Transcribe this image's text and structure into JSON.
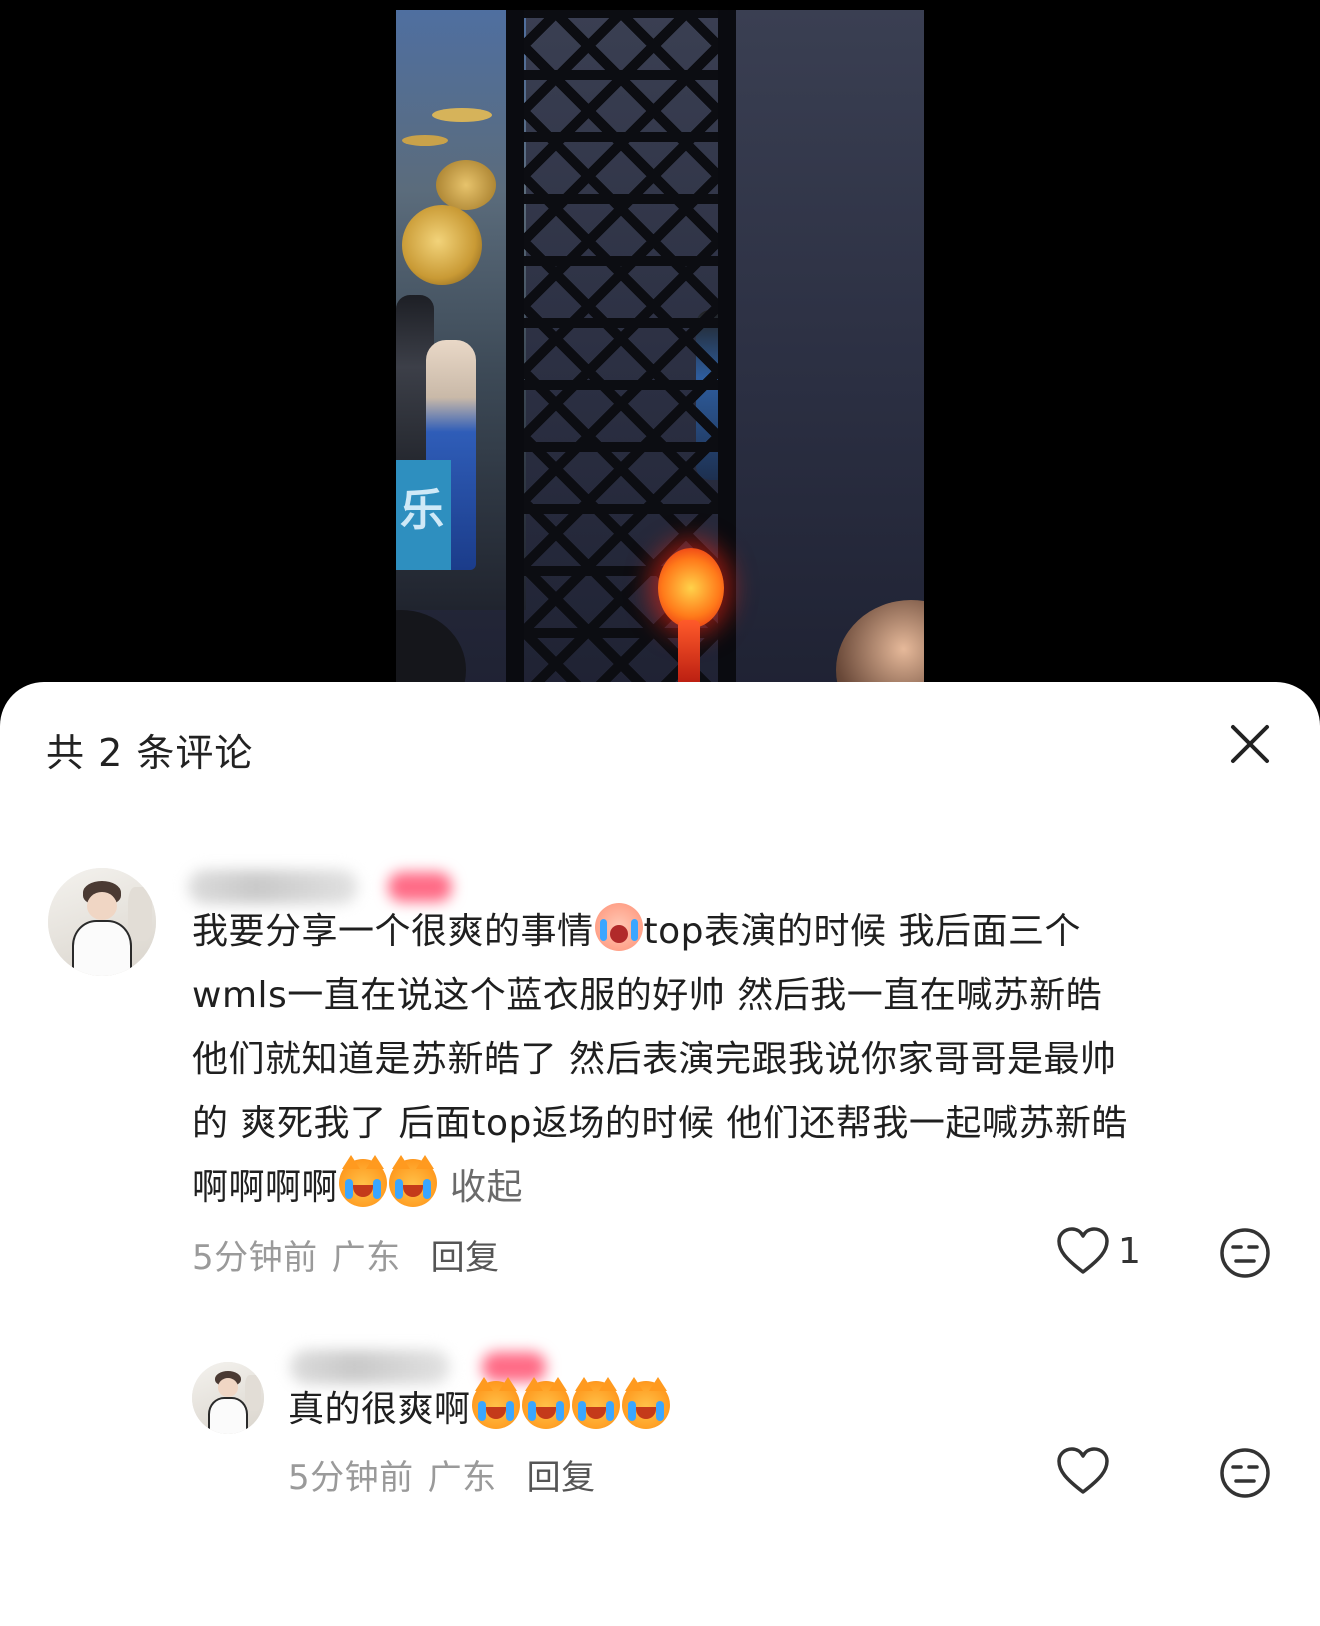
{
  "video": {
    "stage_sign_text": "乐"
  },
  "comments_panel": {
    "title": "共 2 条评论",
    "close_icon": "close-icon"
  },
  "comments": [
    {
      "author": "",
      "lines": [
        "我要分享一个很爽的事情",
        "top表演的时候 我后面三个",
        "wmls一直在说这个蓝衣服的好帅 然后我一直在喊苏新皓",
        "他们就知道是苏新皓了 然后表演完跟我说你家哥哥是最帅",
        "的 爽死我了 后面top返场的时候 他们还帮我一起喊苏新皓",
        "啊啊啊啊"
      ],
      "collapse_label": "收起",
      "time": "5分钟前",
      "location": "广东",
      "reply_label": "回复",
      "like_count": "1"
    },
    {
      "author": "",
      "text": "真的很爽啊",
      "time": "5分钟前",
      "location": "广东",
      "reply_label": "回复",
      "like_count": ""
    }
  ],
  "colors": {
    "sheet_background": "#ffffff",
    "text_primary": "#1f1f1f",
    "text_meta": "#9a9a9a",
    "lightstick": "#ff3b1f"
  }
}
